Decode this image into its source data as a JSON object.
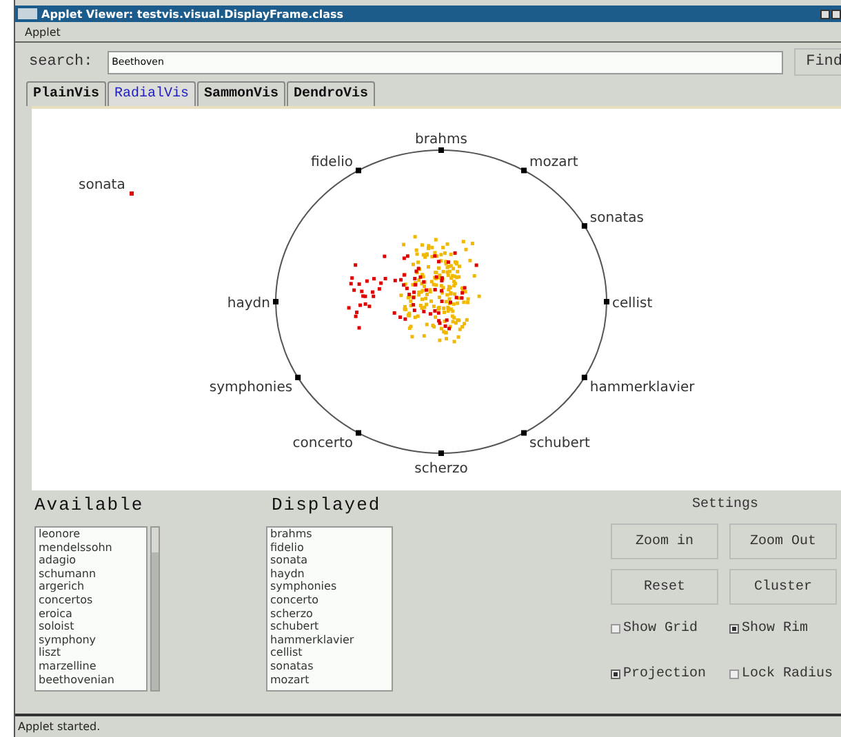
{
  "window": {
    "title": "Applet Viewer: testvis.visual.DisplayFrame.class"
  },
  "menu": [
    "Applet"
  ],
  "search": {
    "label": "search:",
    "value": "Beethoven",
    "button": "Find"
  },
  "tabs": [
    {
      "label": "PlainVis",
      "selected": false
    },
    {
      "label": "RadialVis",
      "selected": true
    },
    {
      "label": "SammonVis",
      "selected": false
    },
    {
      "label": "DendroVis",
      "selected": false
    }
  ],
  "radial": {
    "anchors": [
      "brahms",
      "fidelio",
      "mozart",
      "sonatas",
      "haydn",
      "cellist",
      "symphonies",
      "hammerklavier",
      "concerto",
      "schubert",
      "scherzo"
    ],
    "outlier": {
      "label": "sonata",
      "color": "#e00000"
    },
    "show_rim": true
  },
  "available": {
    "title": "Available",
    "items": [
      "leonore",
      "mendelssohn",
      "adagio",
      "schumann",
      "argerich",
      "concertos",
      "eroica",
      "soloist",
      "symphony",
      "liszt",
      "marzelline",
      "beethovenian"
    ]
  },
  "displayed": {
    "title": "Displayed",
    "items": [
      "brahms",
      "fidelio",
      "sonata",
      "haydn",
      "symphonies",
      "concerto",
      "scherzo",
      "schubert",
      "hammerklavier",
      "cellist",
      "sonatas",
      "mozart"
    ]
  },
  "settings": {
    "title": "Settings",
    "buttons": [
      "Zoom in",
      "Zoom Out",
      "Reset",
      "Cluster"
    ],
    "options": [
      {
        "label": "Show Grid",
        "checked": false
      },
      {
        "label": "Show Rim",
        "checked": true
      },
      {
        "label": "Projection",
        "checked": true
      },
      {
        "label": "Lock Radius",
        "checked": false
      }
    ]
  },
  "status_bar": "Applet started."
}
